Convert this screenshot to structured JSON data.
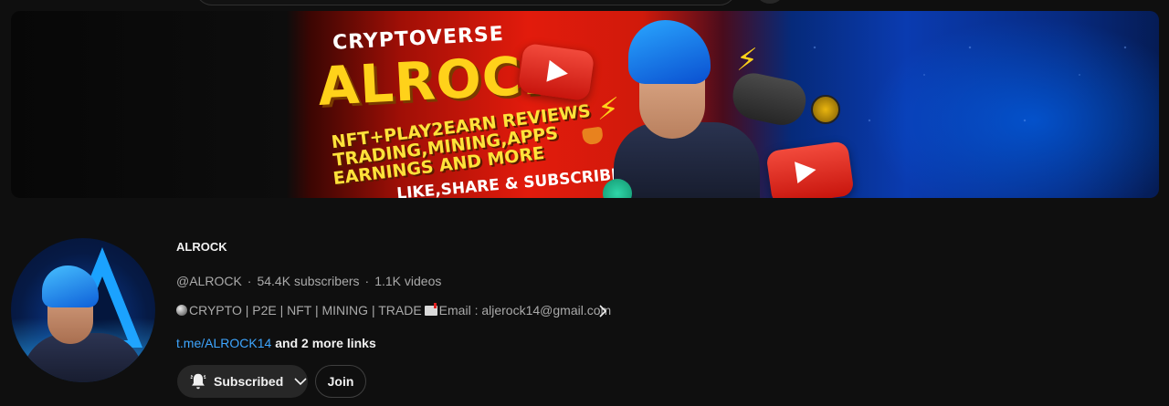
{
  "banner": {
    "brand_top": "CRYPTOVERSE",
    "brand": "ALROCK",
    "line1": "NFT+PLAY2EARN REVIEWS",
    "line2": "TRADING,MINING,APPS",
    "line3": "EARNINGS AND MORE",
    "cta": "LIKE,SHARE & SUBSCRIBE"
  },
  "channel": {
    "name": "ALROCK",
    "handle": "@ALROCK",
    "subscribers": "54.4K subscribers",
    "videos": "1.1K videos",
    "separator": "·",
    "description": "CRYPTO | P2E | NFT | MINING | TRADE",
    "description_email": "Email : aljerock14@gmail.com",
    "link": "t.me/ALROCK14",
    "more_links": "and 2 more links"
  },
  "buttons": {
    "subscribed_label": "Subscribed",
    "join_label": "Join"
  },
  "icons": {
    "bell": "bell-icon",
    "chevron_down": "chevron-down-icon",
    "chevron_right": "chevron-right-icon"
  }
}
